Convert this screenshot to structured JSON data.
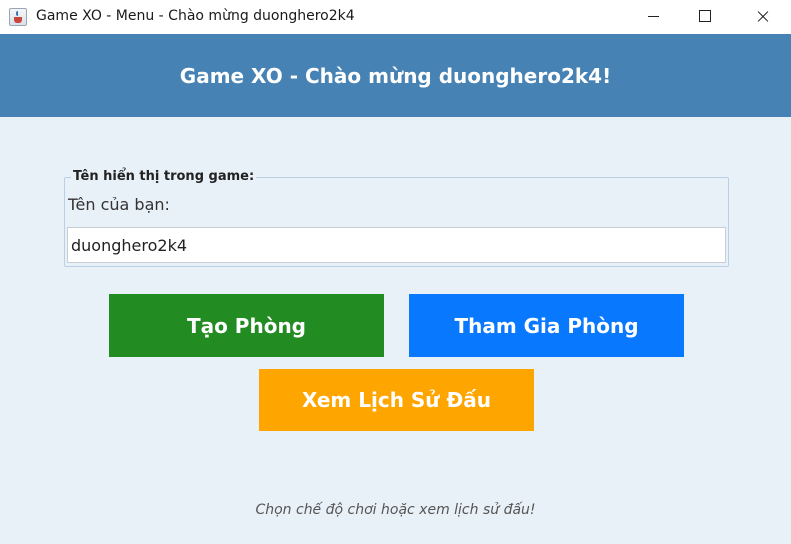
{
  "window": {
    "title": "Game XO - Menu - Chào mừng duonghero2k4",
    "icon": "java-cup-icon",
    "controls": [
      "minimize-icon",
      "maximize-icon",
      "close-icon"
    ]
  },
  "header": {
    "title": "Game XO - Chào mừng duonghero2k4!",
    "background": "#4682b4"
  },
  "name_section": {
    "legend": "Tên hiển thị trong game:",
    "label": "Tên của bạn:",
    "value": "duonghero2k4"
  },
  "buttons": {
    "create_room": {
      "label": "Tạo Phòng",
      "color": "#228b22"
    },
    "join_room": {
      "label": "Tham Gia Phòng",
      "color": "#0878ff"
    },
    "history": {
      "label": "Xem Lịch Sử Đấu",
      "color": "#ffa500"
    }
  },
  "footer": {
    "hint": "Chọn chế độ chơi hoặc xem lịch sử đấu!"
  },
  "colors": {
    "background": "#e8f0f8",
    "header": "#4682b4"
  }
}
